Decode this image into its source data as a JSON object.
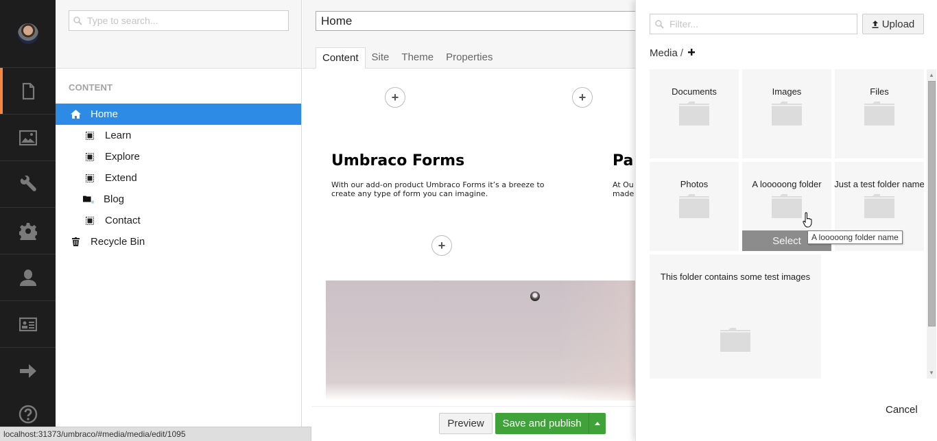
{
  "app_bar": {
    "user_avatar": "user-avatar",
    "sections": [
      {
        "name": "content",
        "icon": "document-icon",
        "active": true
      },
      {
        "name": "media",
        "icon": "image-icon",
        "active": false
      },
      {
        "name": "developer",
        "icon": "wrench-icon",
        "active": false
      },
      {
        "name": "settings",
        "icon": "gear-icon",
        "active": false
      },
      {
        "name": "users",
        "icon": "user-icon",
        "active": false
      },
      {
        "name": "members",
        "icon": "id-card-icon",
        "active": false
      },
      {
        "name": "forms",
        "icon": "arrow-right-icon",
        "active": false
      }
    ],
    "help_icon": "help-icon",
    "accent_color": "#f5853f"
  },
  "tree": {
    "search_placeholder": "Type to search...",
    "section_title": "CONTENT",
    "items": [
      {
        "label": "Home",
        "icon": "home-icon",
        "selected": true,
        "level": 0
      },
      {
        "label": "Learn",
        "icon": "content-block-icon",
        "level": 1
      },
      {
        "label": "Explore",
        "icon": "content-block-icon",
        "level": 1
      },
      {
        "label": "Extend",
        "icon": "content-block-icon",
        "level": 1
      },
      {
        "label": "Blog",
        "icon": "folder-list-icon",
        "level": 1
      },
      {
        "label": "Contact",
        "icon": "content-block-icon",
        "level": 1
      },
      {
        "label": "Recycle Bin",
        "icon": "trash-icon",
        "level": 0
      }
    ],
    "selected_color": "#2d8ae5"
  },
  "editor": {
    "name_value": "Home",
    "tabs": [
      {
        "label": "Content",
        "active": true
      },
      {
        "label": "Site"
      },
      {
        "label": "Theme"
      },
      {
        "label": "Properties"
      }
    ],
    "blocks": [
      {
        "title": "Umbraco Forms",
        "text": "With our add-on product Umbraco Forms it’s a breeze to create any type of form you can imagine."
      },
      {
        "title": "Pa",
        "text_line1": "At Ou",
        "text_line2": "made"
      }
    ],
    "preview_label": "Preview",
    "publish_label": "Save and publish",
    "publish_color": "#3fa33a"
  },
  "status_bar": {
    "url": "localhost:31373/umbraco/#media/media/edit/1095"
  },
  "media_picker": {
    "filter_placeholder": "Filter...",
    "upload_label": "Upload",
    "breadcrumb_root": "Media",
    "breadcrumb_separator": "/",
    "folders": [
      {
        "name": "Documents"
      },
      {
        "name": "Images"
      },
      {
        "name": "Files"
      },
      {
        "name": "Photos"
      },
      {
        "name": "A looooong folder name",
        "hovered": true
      },
      {
        "name": "Just a test folder name"
      },
      {
        "name": "This folder contains some test images"
      }
    ],
    "select_label": "Select",
    "tooltip": "A looooong folder name",
    "cancel_label": "Cancel"
  }
}
